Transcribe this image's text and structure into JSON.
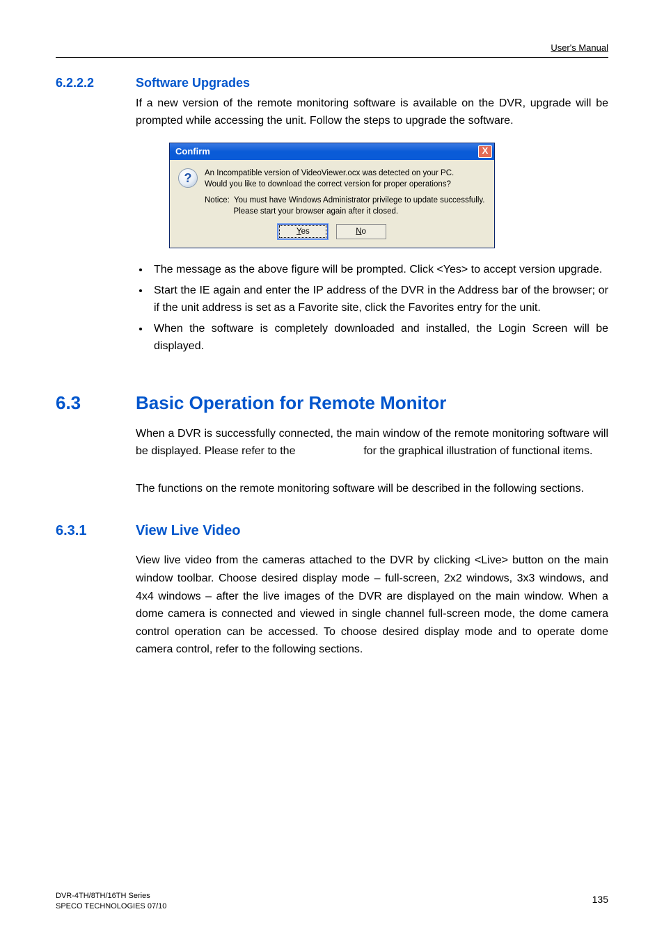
{
  "header": {
    "right": "User's Manual"
  },
  "s6222": {
    "num": "6.2.2.2",
    "title": "Software Upgrades",
    "para": "If a new version of the remote monitoring software is available on the DVR, upgrade will be prompted while accessing the unit. Follow the steps to upgrade the software."
  },
  "dialog": {
    "title": "Confirm",
    "close": "X",
    "qmark": "?",
    "line1": "An Incompatible version of VideoViewer.ocx was detected on your PC.",
    "line2": "Would you like to download the correct version for proper operations?",
    "notice_prefix": "Notice:",
    "notice_l1": "You must have Windows Administrator privilege to update successfully.",
    "notice_l2": "Please start your browser again after it closed.",
    "yes_u": "Y",
    "yes_rest": "es",
    "no_u": "N",
    "no_rest": "o"
  },
  "bullets": {
    "b1": "The message as the above figure will be prompted. Click <Yes> to accept version upgrade.",
    "b2": "Start the IE again and enter the IP address of the DVR in the Address bar of the browser; or if the unit address is set as a Favorite site, click the Favorites entry for the unit.",
    "b3": "When the software is completely downloaded and installed, the Login Screen will be displayed."
  },
  "s63": {
    "num": "6.3",
    "title": "Basic Operation for Remote Monitor",
    "p1a": "When a DVR is successfully connected, the main window of the remote monitoring software will be displayed. Please refer to the ",
    "p1b": " for the graphical illustration of functional items.",
    "p2": "The functions on the remote monitoring software will be described in the following sections."
  },
  "s631": {
    "num": "6.3.1",
    "title": "View Live Video",
    "para": "View live video from the cameras attached to the DVR by clicking <Live> button on the main window toolbar. Choose desired display mode – full-screen, 2x2 windows, 3x3 windows, and 4x4 windows – after the live images of the DVR are displayed on the main window. When a dome camera is connected and viewed in single channel full-screen mode, the dome camera control operation can be accessed. To choose desired display mode and to operate dome camera control, refer to the following sections."
  },
  "footer": {
    "l1": "DVR-4TH/8TH/16TH Series",
    "l2": "SPECO TECHNOLOGIES 07/10",
    "page": "135"
  }
}
